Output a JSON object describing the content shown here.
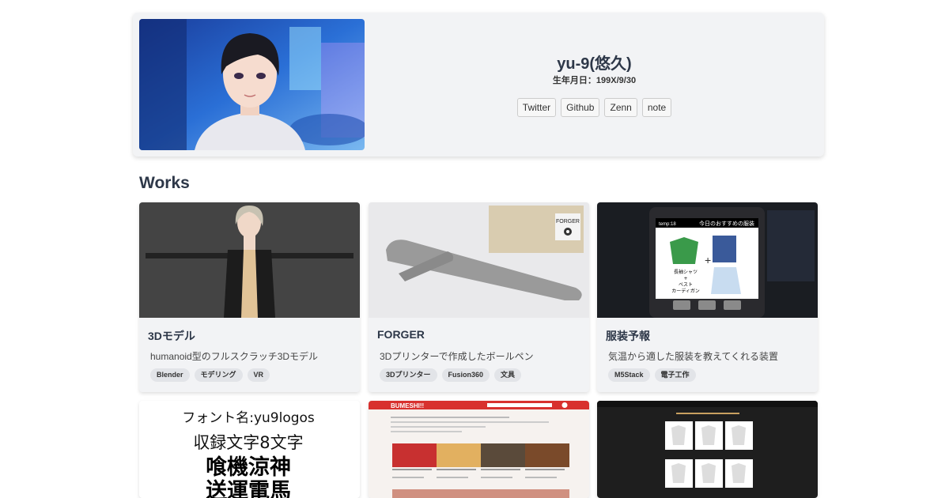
{
  "profile": {
    "name": "yu-9(悠久)",
    "birthday": "生年月日：199X/9/30",
    "links": [
      "Twitter",
      "Github",
      "Zenn",
      "note"
    ]
  },
  "works_heading": "Works",
  "works": [
    {
      "title": "3Dモデル",
      "description": "humanoid型のフルスクラッチ3Dモデル",
      "tags": [
        "Blender",
        "モデリング",
        "VR"
      ],
      "thumbnail": "3d-model-thumbnail"
    },
    {
      "title": "FORGER",
      "description": "3Dプリンターで作成したボールペン",
      "tags": [
        "3Dプリンター",
        "Fusion360",
        "文具"
      ],
      "thumbnail": "pen-thumbnail",
      "thumbnail_text": "FORGER"
    },
    {
      "title": "服装予報",
      "description": "気温から適した服装を教えてくれる装置",
      "tags": [
        "M5Stack",
        "電子工作"
      ],
      "thumbnail": "m5stack-thumbnail",
      "thumbnail_text": {
        "temp": "temp:18",
        "heading": "今日のおすすめの服装",
        "line1": "長袖シャツ",
        "line2": "+",
        "line3": "ベスト",
        "line4": "カーディガン"
      }
    },
    {
      "thumbnail": "font-thumbnail",
      "thumbnail_text": {
        "line1": "フォント名:yu9logos",
        "line2": "収録文字8文字",
        "line3": "喰機涼神",
        "line4": "送運電馬"
      }
    },
    {
      "thumbnail": "bumeshi-thumbnail",
      "thumbnail_text": "BUMESHI!!"
    },
    {
      "thumbnail": "clothing-app-thumbnail"
    }
  ]
}
